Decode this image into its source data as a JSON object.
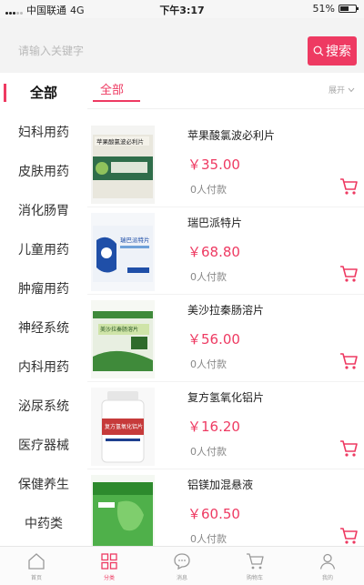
{
  "status_bar": {
    "carrier": "中国联通",
    "network": "4G",
    "time": "下午3:17",
    "battery": "51%"
  },
  "search": {
    "placeholder": "请输入关键字",
    "button_label": "搜索"
  },
  "sidebar": {
    "items": [
      {
        "label": "全部",
        "active": true
      },
      {
        "label": "妇科用药"
      },
      {
        "label": "皮肤用药"
      },
      {
        "label": "消化肠胃"
      },
      {
        "label": "儿童用药"
      },
      {
        "label": "肿瘤用药"
      },
      {
        "label": "神经系统"
      },
      {
        "label": "内科用药"
      },
      {
        "label": "泌尿系统"
      },
      {
        "label": "医疗器械"
      },
      {
        "label": "保健养生"
      },
      {
        "label": "中药类"
      }
    ]
  },
  "tabs": {
    "all_label": "全部",
    "expand_label": "展开"
  },
  "products": [
    {
      "name": "苹果酸氯波必利片",
      "price": "￥35.00",
      "sold": "0人付款",
      "box_text": "苹果酸氯波必利片"
    },
    {
      "name": "瑞巴派特片",
      "price": "￥68.80",
      "sold": "0人付款",
      "box_text": "瑞巴派特片"
    },
    {
      "name": "美沙拉秦肠溶片",
      "price": "￥56.00",
      "sold": "0人付款",
      "box_text": "美沙拉秦肠溶片"
    },
    {
      "name": "复方氢氧化铝片",
      "price": "￥16.20",
      "sold": "0人付款",
      "box_text": "复方氢氧化铝片"
    },
    {
      "name": "铝镁加混悬液",
      "price": "￥60.50",
      "sold": "0人付款",
      "box_text": ""
    }
  ],
  "bottom_nav": [
    {
      "label": "首页"
    },
    {
      "label": "分类",
      "active": true
    },
    {
      "label": "消息"
    },
    {
      "label": "购物车"
    },
    {
      "label": "我的"
    }
  ],
  "colors": {
    "accent": "#ee3a62"
  }
}
